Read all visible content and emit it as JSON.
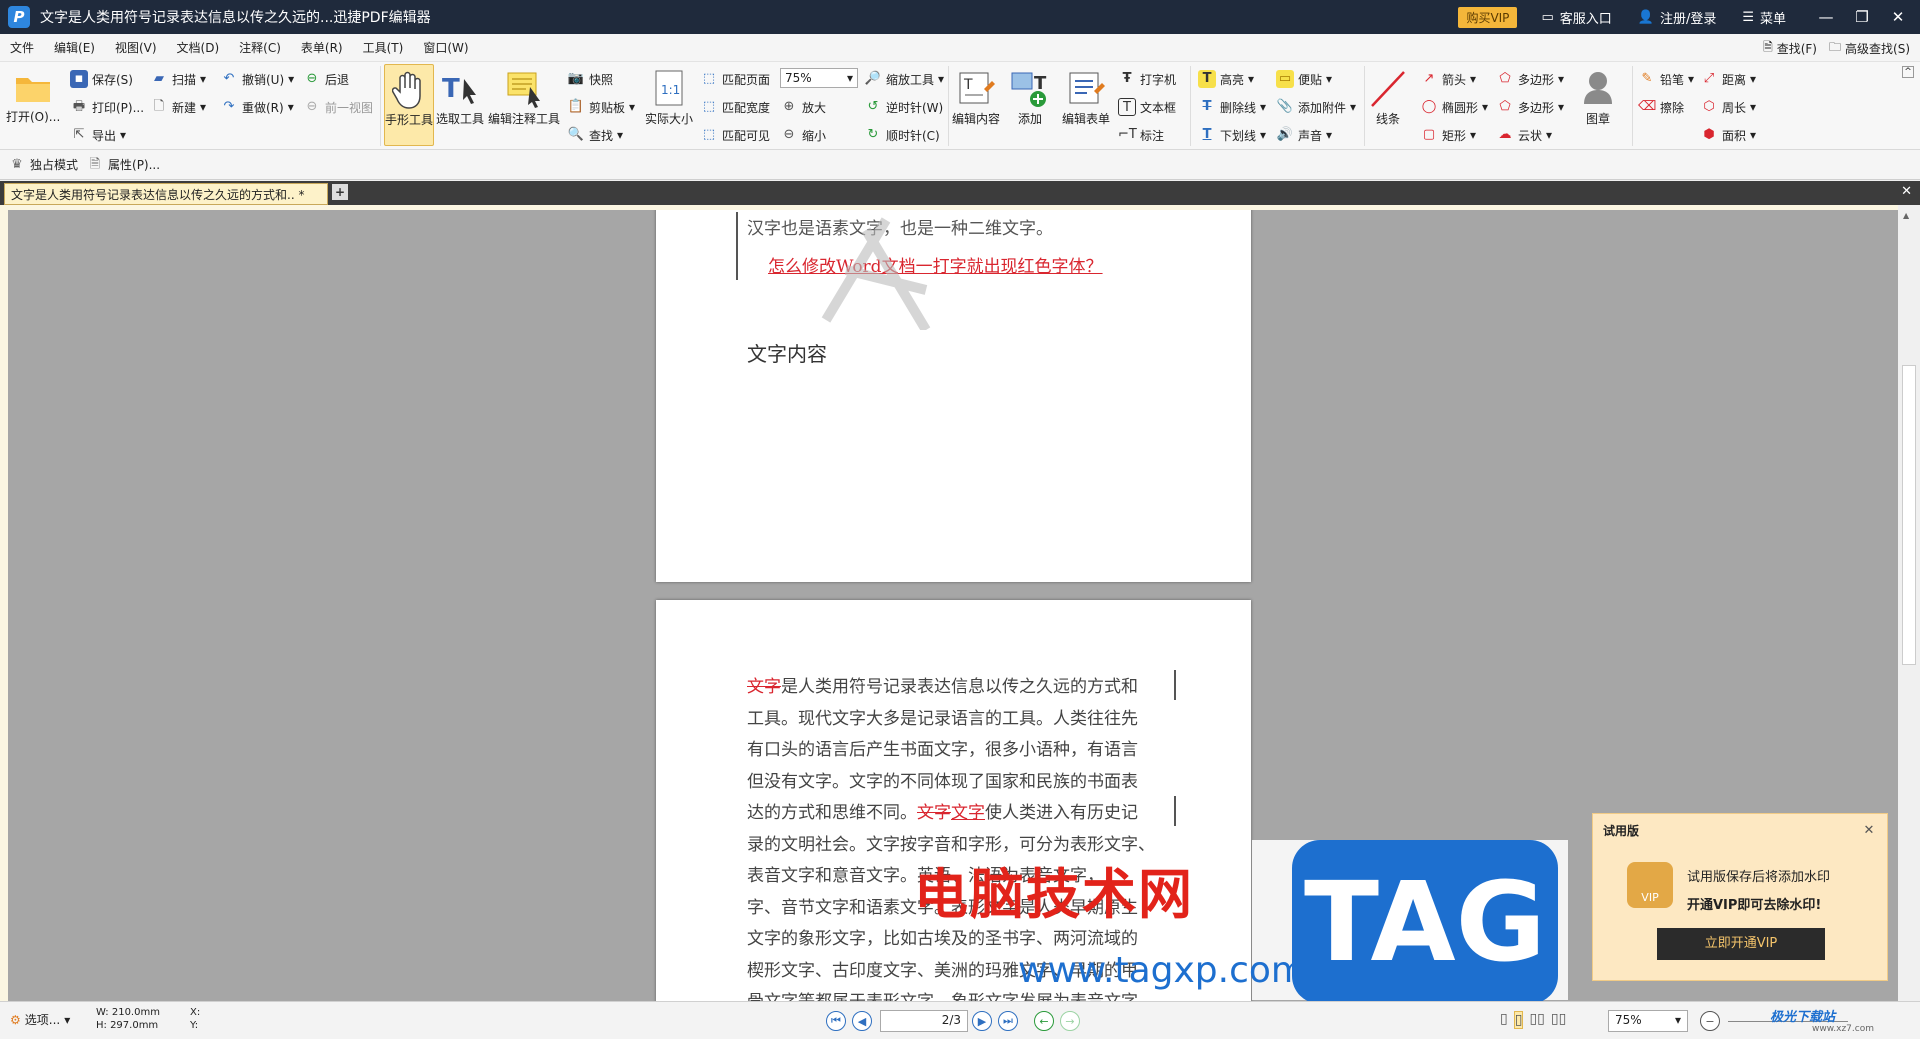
{
  "titlebar": {
    "logo": "P",
    "title": "文字是人类用符号记录表达信息以传之久远的...迅捷PDF编辑器",
    "vip": "购买VIP",
    "service": "客服入口",
    "login": "注册/登录",
    "menu": "菜单",
    "min": "—",
    "max": "❐",
    "close": "✕"
  },
  "menu": {
    "items": [
      "文件",
      "编辑(E)",
      "视图(V)",
      "文档(D)",
      "注释(C)",
      "表单(R)",
      "工具(T)",
      "窗口(W)"
    ],
    "find": "查找(F)",
    "adv_find": "高级查找(S)"
  },
  "ribbon": {
    "open": "打开(O)...",
    "save": "保存(S)",
    "print": "打印(P)...",
    "export": "导出",
    "scan": "扫描",
    "new": "新建",
    "undo": "撤销(U)",
    "redo": "重做(R)",
    "back": "后退",
    "prev_view": "前一视图",
    "hand": "手形工具",
    "select": "选取工具",
    "edit_annot": "编辑注释工具",
    "snapshot": "快照",
    "clipboard": "剪贴板",
    "search": "查找",
    "actual_size": "实际大小",
    "fit_page": "匹配页面",
    "fit_width": "匹配宽度",
    "fit_visible": "匹配可见",
    "zoom_value": "75%",
    "zoom_tool": "缩放工具",
    "zoom_in": "放大",
    "zoom_out": "缩小",
    "ccw": "逆时针(W)",
    "cw": "顺时针(C)",
    "edit_content": "编辑内容",
    "add": "添加",
    "edit_form": "编辑表单",
    "typewriter": "打字机",
    "textbox": "文本框",
    "callout": "标注",
    "highlight": "高亮",
    "strike": "删除线",
    "underline": "下划线",
    "note": "便贴",
    "attach": "添加附件",
    "sound": "声音",
    "line": "线条",
    "arrow": "箭头",
    "ellipse": "椭圆形",
    "rect": "矩形",
    "polygon": "多边形",
    "polyline": "多边形",
    "cloud": "云状",
    "stamp": "图章",
    "pencil": "铅笔",
    "eraser": "擦除",
    "distance": "距离",
    "perimeter": "周长",
    "area": "面积"
  },
  "subbar": {
    "exclusive": "独占模式",
    "props": "属性(P)..."
  },
  "tab": {
    "label": "文字是人类用符号记录表达信息以传之久远的方式和.. *",
    "add": "+",
    "close": "✕"
  },
  "page1": {
    "top_line": "汉字也是语素文字，也是一种二维文字。",
    "red_link": "怎么修改Word文档一打字就出现红色字体？",
    "heading": "文字内容"
  },
  "page2": {
    "lines": [
      [
        "文字",
        "是人类用符号记录表达信息以传之久远的方式和"
      ],
      [
        "",
        "工具。现代文字大多是记录语言的工具。人类往往先"
      ],
      [
        "",
        "有口头的语言后产生书面文字，很多小语种，有语言"
      ],
      [
        "",
        "但没有文字。文字的不同体现了国家和民族的书面表"
      ],
      [
        "",
        "达的方式和思维不同。"
      ],
      [
        "",
        "录的文明社会。文字按字音和字形，可分为表形文字、"
      ],
      [
        "",
        "表音文字和意音文字。英语、法语为表音文字，"
      ],
      [
        "",
        "字、音节文字和语素文字。表形文字是人类早期原生"
      ],
      [
        "",
        "文字的象形文字，比如古埃及的圣书字、两河流域的"
      ],
      [
        "",
        "楔形文字、古印度文字、美洲的玛雅文字、早期的甲"
      ],
      [
        "",
        "骨文字等都属于表形文字，象形文字发展为表音文字"
      ]
    ],
    "strike2": "文字",
    "inserted": "文字",
    "after_insert": "使人类进入有历史记"
  },
  "watermark": {
    "cn": "电脑技术网",
    "url": "www.tagxp.com",
    "tag": "TAG"
  },
  "popup": {
    "title": "试用版",
    "line1": "试用版保存后将添加水印",
    "line2": "开通VIP即可去除水印!",
    "button": "立即开通VIP",
    "vip_badge": "VIP"
  },
  "status": {
    "options": "选项...",
    "w": "W: 210.0mm",
    "h": "H: 297.0mm",
    "x": "X:",
    "y": "Y:",
    "page": "2/3",
    "zoom": "75%",
    "site": "极光下载站",
    "site_url": "www.xz7.com"
  }
}
